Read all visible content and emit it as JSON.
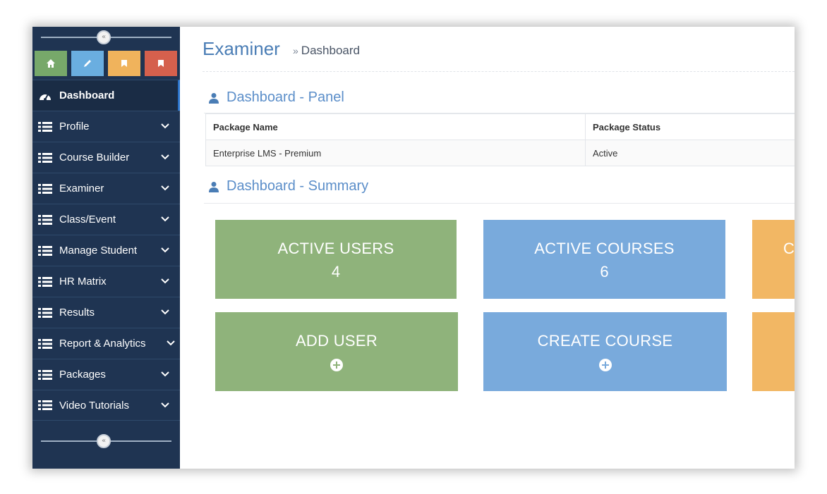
{
  "colors": {
    "sidebar_bg": "#1f3452",
    "accent_blue": "#4a7db5",
    "tile_green": "#8fb37b",
    "tile_blue": "#79aadc",
    "tile_orange": "#f2b764",
    "quick_green": "#77a86a",
    "quick_blue": "#6aaee0",
    "quick_orange": "#f0b35c",
    "quick_red": "#d5604d"
  },
  "quick_buttons": [
    {
      "icon": "home-icon",
      "color": "#77a86a"
    },
    {
      "icon": "pencil-icon",
      "color": "#6aaee0"
    },
    {
      "icon": "bookmark-icon",
      "color": "#f0b35c"
    },
    {
      "icon": "bookmark-icon",
      "color": "#d5604d"
    }
  ],
  "sidebar": {
    "items": [
      {
        "label": "Dashboard",
        "icon": "dashboard-icon",
        "active": true
      },
      {
        "label": "Profile",
        "icon": "list-icon"
      },
      {
        "label": "Course Builder",
        "icon": "list-icon"
      },
      {
        "label": "Examiner",
        "icon": "list-icon"
      },
      {
        "label": "Class/Event",
        "icon": "list-icon"
      },
      {
        "label": "Manage Student",
        "icon": "list-icon"
      },
      {
        "label": "HR Matrix",
        "icon": "list-icon"
      },
      {
        "label": "Results",
        "icon": "list-icon"
      },
      {
        "label": "Report & Analytics",
        "icon": "list-icon"
      },
      {
        "label": "Packages",
        "icon": "list-icon"
      },
      {
        "label": "Video Tutorials",
        "icon": "list-icon"
      }
    ]
  },
  "header": {
    "title": "Examiner",
    "breadcrumb_sep": "»",
    "breadcrumb": "Dashboard"
  },
  "panel": {
    "title": "Dashboard - Panel",
    "columns": [
      "Package Name",
      "Package Status"
    ],
    "rows": [
      [
        "Enterprise LMS - Premium",
        "Active"
      ]
    ]
  },
  "summary": {
    "title": "Dashboard - Summary",
    "tiles": [
      {
        "label": "ACTIVE USERS",
        "value": "4"
      },
      {
        "label": "ACTIVE COURSES",
        "value": "6"
      },
      {
        "label": "C",
        "value": ""
      },
      {
        "label": "ADD USER",
        "icon": "plus-circle-icon"
      },
      {
        "label": "CREATE COURSE",
        "icon": "plus-circle-icon"
      },
      {
        "label": "",
        "icon": ""
      }
    ]
  }
}
